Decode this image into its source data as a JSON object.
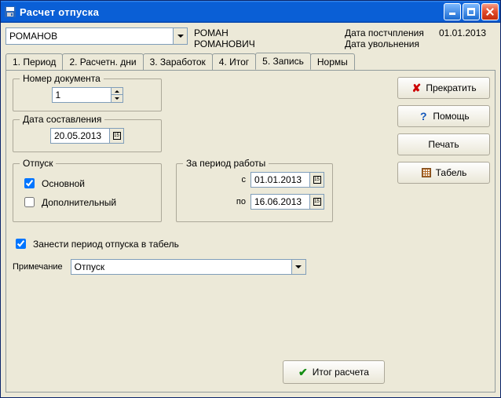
{
  "window": {
    "title": "Расчет отпуска"
  },
  "header": {
    "surname_value": "РОМАНОВ",
    "first_name": "РОМАН",
    "patronymic": "РОМАНОВИЧ",
    "hire_label": "Дата постчпления",
    "hire_value": "01.01.2013",
    "fire_label": "Дата увольнения",
    "fire_value": ""
  },
  "tabs": [
    {
      "label": "1. Период"
    },
    {
      "label": "2. Расчетн. дни"
    },
    {
      "label": "3. Заработок"
    },
    {
      "label": "4. Итог"
    },
    {
      "label": "5. Запись"
    },
    {
      "label": "Нормы"
    }
  ],
  "side_buttons": {
    "cancel": "Прекратить",
    "help": "Помощь",
    "print": "Печать",
    "tabel": "Табель"
  },
  "doc": {
    "group_label": "Номер документа",
    "number": "1",
    "date_group_label": "Дата составления",
    "date": "20.05.2013"
  },
  "vac": {
    "group_label": "Отпуск",
    "main_label": "Основной",
    "main_checked": true,
    "extra_label": "Дополнительный",
    "extra_checked": false
  },
  "period": {
    "group_label": "За период работы",
    "from_label": "с",
    "from_value": "01.01.2013",
    "to_label": "по",
    "to_value": "16.06.2013"
  },
  "to_tabel": {
    "label": "Занести период отпуска в табель",
    "checked": true
  },
  "note": {
    "label": "Примечание",
    "value": "Отпуск"
  },
  "bottom_button": "Итог расчета"
}
